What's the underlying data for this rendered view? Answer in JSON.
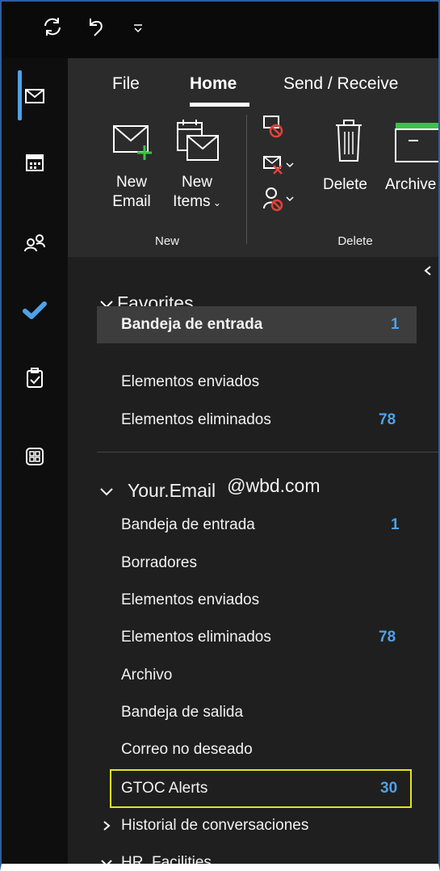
{
  "ribbon": {
    "tabs": [
      "File",
      "Home",
      "Send / Receive"
    ],
    "active_tab": "Home",
    "new_email": {
      "line1": "New",
      "line2": "Email"
    },
    "new_items": {
      "line1": "New",
      "line2": "Items"
    },
    "delete_label": "Delete",
    "archive_label": "Archive",
    "group_new": "New",
    "group_delete": "Delete"
  },
  "favorites": {
    "header": "Favorites",
    "items": [
      {
        "label": "Bandeja de entrada",
        "count": "1"
      },
      {
        "label": "Elementos enviados",
        "count": ""
      },
      {
        "label": "Elementos eliminados",
        "count": "78"
      }
    ]
  },
  "account": {
    "name": "Your.Email",
    "domain": "@wbd.com",
    "items": [
      {
        "label": "Bandeja de entrada",
        "count": "1"
      },
      {
        "label": "Borradores",
        "count": ""
      },
      {
        "label": "Elementos enviados",
        "count": ""
      },
      {
        "label": "Elementos eliminados",
        "count": "78"
      },
      {
        "label": "Archivo",
        "count": ""
      },
      {
        "label": "Bandeja de salida",
        "count": ""
      },
      {
        "label": "Correo no deseado",
        "count": ""
      },
      {
        "label": "GTOC Alerts",
        "count": "30"
      }
    ],
    "subfolders": [
      {
        "label": "Historial de conversaciones"
      },
      {
        "label": "HR, Facilities"
      }
    ]
  },
  "colors": {
    "accent": "#4ea2e8",
    "highlight": "#e5e51f",
    "badge_red": "#e0443a",
    "green": "#3cc14a"
  },
  "icons": [
    "sync-icon",
    "undo-icon",
    "customize-icon",
    "mail-icon",
    "calendar-icon",
    "people-icon",
    "todo-icon",
    "tasks-icon",
    "apps-icon",
    "collapse-icon"
  ]
}
